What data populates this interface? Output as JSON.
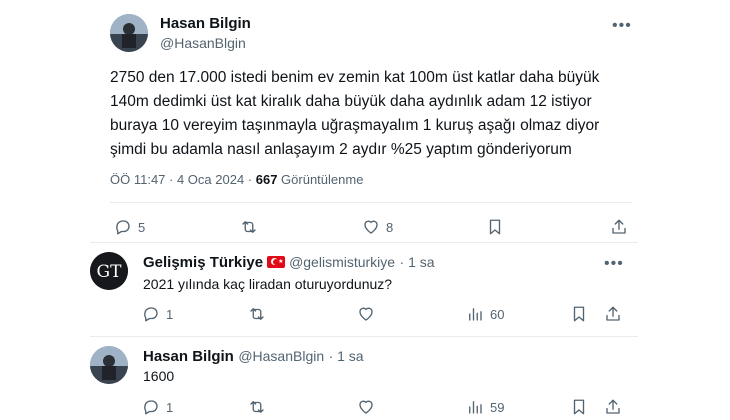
{
  "main_tweet": {
    "author_name": "Hasan Bilgin",
    "author_handle": "@HasanBlgin",
    "text_lines": [
      "2750 den 17.000 istedi benim ev zemin kat 100m üst katlar daha büyük",
      "140m dedimki üst kat kiralık daha büyük daha aydınlık adam 12 istiyor",
      "buraya 10 vereyim taşınmayla uğraşmayalım 1 kuruş aşağı olmaz diyor",
      "şimdi bu adamla nasıl anlaşayım 2 aydır %25 yaptım gönderiyorum"
    ],
    "time": "ÖÖ 11:47 · 4 Oca 2024 · ",
    "views_count": "667",
    "views_label": " Görüntülenme",
    "actions": {
      "replies": "5",
      "retweets": "",
      "likes": "8"
    }
  },
  "reply_1": {
    "author_name": "Gelişmiş Türkiye",
    "author_handle": "@gelismisturkiye",
    "time": "· 1 sa",
    "text": "2021 yılında kaç liradan oturuyordunuz?",
    "actions": {
      "replies": "1",
      "retweets": "",
      "likes": "",
      "views": "60"
    }
  },
  "reply_2": {
    "author_name": "Hasan Bilgin",
    "author_handle": "@HasanBlgin",
    "time": "· 1 sa",
    "text": "1600",
    "actions": {
      "replies": "1",
      "retweets": "",
      "likes": "",
      "views": "59"
    }
  },
  "icons": {
    "more": "more-icon",
    "reply": "reply-icon",
    "retweet": "retweet-icon",
    "like": "heart-icon",
    "bookmark": "bookmark-icon",
    "share": "share-icon",
    "views": "views-icon"
  },
  "colors": {
    "text": "#0f1419",
    "secondary": "#536471",
    "divider": "#e6ecf0",
    "flag_red": "#e30a17"
  }
}
